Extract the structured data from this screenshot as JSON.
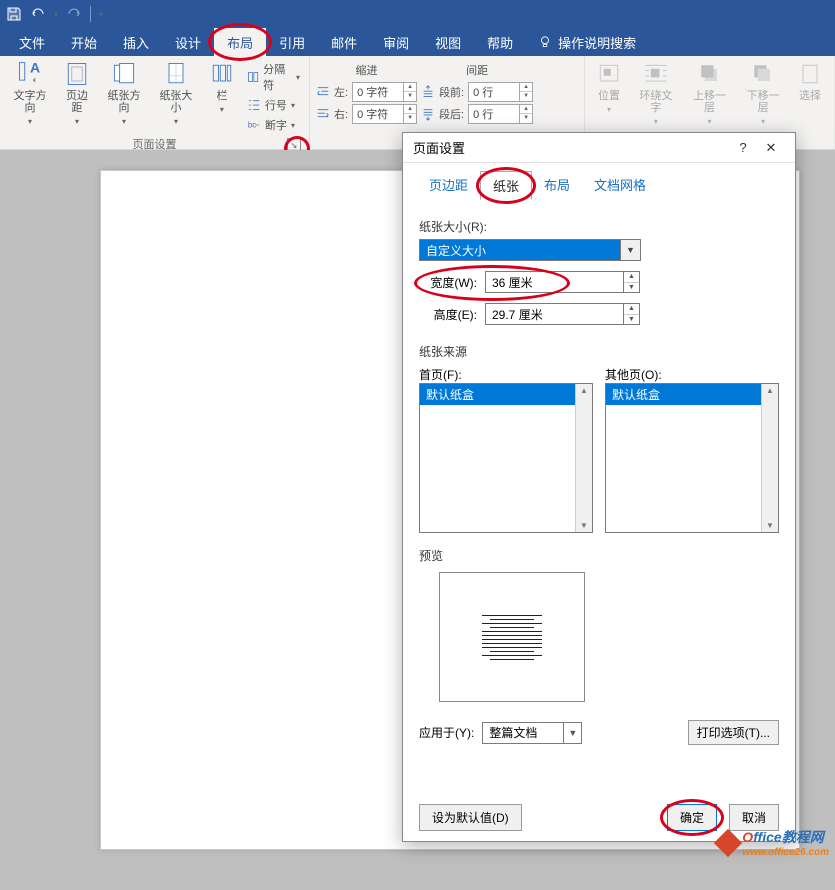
{
  "tabs": {
    "file": "文件",
    "home": "开始",
    "insert": "插入",
    "design": "设计",
    "layout": "布局",
    "references": "引用",
    "mailings": "邮件",
    "review": "审阅",
    "view": "视图",
    "help": "帮助",
    "tell_me": "操作说明搜索"
  },
  "ribbon": {
    "text_direction": "文字方向",
    "margins": "页边距",
    "orientation": "纸张方向",
    "size": "纸张大小",
    "columns": "栏",
    "breaks": "分隔符",
    "line_numbers": "行号",
    "hyphenation": "断字",
    "group_page_setup": "页面设置",
    "indent_header": "缩进",
    "indent_left_label": "左:",
    "indent_right_label": "右:",
    "indent_left_val": "0 字符",
    "indent_right_val": "0 字符",
    "spacing_header": "间距",
    "spacing_before_label": "段前:",
    "spacing_after_label": "段后:",
    "spacing_before_val": "0 行",
    "spacing_after_val": "0 行",
    "position": "位置",
    "wrap": "环绕文字",
    "bring_forward": "上移一层",
    "send_backward": "下移一层",
    "selection": "选择"
  },
  "dialog": {
    "title": "页面设置",
    "tab_margins": "页边距",
    "tab_paper": "纸张",
    "tab_layout": "布局",
    "tab_grid": "文档网格",
    "paper_size_label": "纸张大小(R):",
    "paper_size_selected": "自定义大小",
    "width_label": "宽度(W):",
    "width_val": "36 厘米",
    "height_label": "高度(E):",
    "height_val": "29.7 厘米",
    "source_label": "纸张来源",
    "first_page_label": "首页(F):",
    "other_pages_label": "其他页(O):",
    "tray_default": "默认纸盒",
    "preview_label": "预览",
    "apply_label": "应用于(Y):",
    "apply_val": "整篇文档",
    "print_options": "打印选项(T)...",
    "set_default": "设为默认值(D)",
    "ok": "确定",
    "cancel": "取消"
  },
  "watermark": {
    "brand_o": "O",
    "brand_rest": "ffice教程网",
    "url": "www.office26.com"
  }
}
